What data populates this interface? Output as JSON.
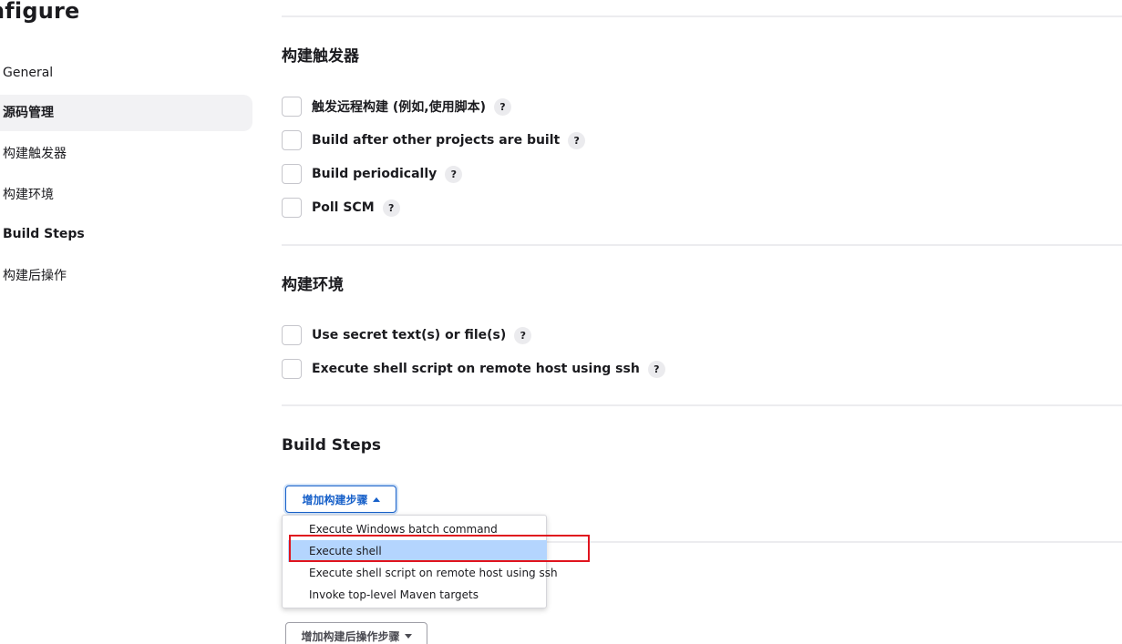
{
  "header": {
    "title": "nfigure"
  },
  "sidebar": {
    "items": [
      {
        "label": "General"
      },
      {
        "label": "源码管理"
      },
      {
        "label": "构建触发器"
      },
      {
        "label": "构建环境"
      },
      {
        "label": "Build Steps"
      },
      {
        "label": "构建后操作"
      }
    ],
    "active_index": 1
  },
  "sections": {
    "triggers": {
      "title": "构建触发器",
      "options": [
        {
          "label": "触发远程构建 (例如,使用脚本)",
          "checked": false
        },
        {
          "label": "Build after other projects are built",
          "checked": false
        },
        {
          "label": "Build periodically",
          "checked": false
        },
        {
          "label": "Poll SCM",
          "checked": false
        }
      ]
    },
    "environment": {
      "title": "构建环境",
      "options": [
        {
          "label": "Use secret text(s) or file(s)",
          "checked": false
        },
        {
          "label": "Execute shell script on remote host using ssh",
          "checked": false
        }
      ]
    },
    "build_steps": {
      "title": "Build Steps",
      "add_button_label": "增加构建步骤",
      "dropdown_items": [
        {
          "label": "Execute Windows batch command"
        },
        {
          "label": "Execute shell"
        },
        {
          "label": "Execute shell script on remote host using ssh"
        },
        {
          "label": "Invoke top-level Maven targets"
        }
      ],
      "highlighted_item": "Execute shell"
    },
    "post_build": {
      "add_button_label": "增加构建后操作步骤"
    }
  },
  "help_glyph": "?",
  "colors": {
    "accent": "#1760c9",
    "highlight_bg": "#b4d5fe",
    "annotation_red": "#e0141e",
    "sidebar_active_bg": "#f2f2f4"
  }
}
